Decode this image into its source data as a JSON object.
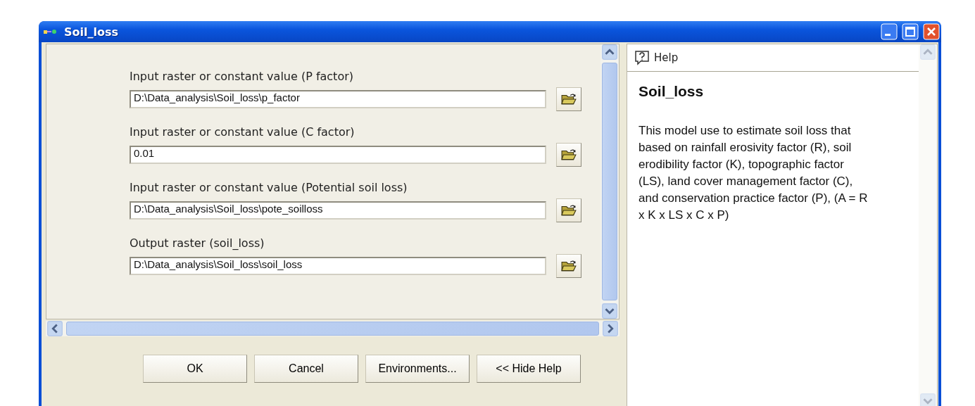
{
  "window": {
    "title": "Soil_loss"
  },
  "parameters": [
    {
      "label": "Input raster or constant value (P factor)",
      "value": "D:\\Data_analysis\\Soil_loss\\p_factor"
    },
    {
      "label": "Input raster or constant value (C factor)",
      "value": "0.01"
    },
    {
      "label": "Input raster or constant value (Potential soil loss)",
      "value": "D:\\Data_analysis\\Soil_loss\\pote_soilloss"
    },
    {
      "label": "Output raster (soil_loss)",
      "value": "D:\\Data_analysis\\Soil_loss\\soil_loss"
    }
  ],
  "buttons": [
    "OK",
    "Cancel",
    "Environments...",
    "<< Hide Help"
  ],
  "help": {
    "tab": "Help",
    "title": "Soil_loss",
    "text": "This model use to estimate soil loss that based on rainfall erosivity factor (R), soil erodibility factor (K), topographic factor (LS), land cover management factor (C), and conservation practice factor (P), (A = R x K x LS x C x P)"
  }
}
